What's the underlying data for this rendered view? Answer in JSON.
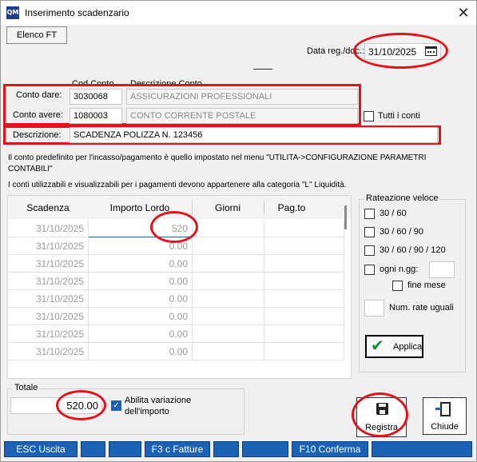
{
  "window": {
    "title": "Inserimento scadenzario",
    "icon_text": "QM",
    "close_glyph": "✕"
  },
  "toolbar": {
    "elenco_ft_label": "Elenco FT"
  },
  "date": {
    "label": "Data reg./doc.:",
    "value": "31/10/2025"
  },
  "accounts": {
    "col_code_header": "Cod.Conto",
    "col_desc_header": "Descrizione Conto",
    "dare_label": "Conto dare:",
    "dare_code": "3030068",
    "dare_desc": "ASSICURAZIONI PROFESSIONALI",
    "avere_label": "Conto avere:",
    "avere_code": "1080003",
    "avere_desc": "CONTO CORRENTE POSTALE",
    "tutti_conti_label": "Tutti i conti"
  },
  "description": {
    "label": "Descrizione:",
    "value": "SCADENZA POLIZZA N. 123456"
  },
  "info": {
    "line1": "Il conto predefinito per l'incasso/pagamento è quello impostato nel menu \"UTILITA->CONFIGURAZIONE PARAMETRI CONTABILI\"",
    "line2": "I conti utilizzabili e visualizzabili per i pagamenti devono appartenere alla categoria \"L\" Liquidità."
  },
  "grid": {
    "headers": [
      "Scadenza",
      "Importo Lordo",
      "Giorni",
      "Pag.to"
    ],
    "rows": [
      {
        "scadenza": "31/10/2025",
        "importo": "520"
      },
      {
        "scadenza": "31/10/2025",
        "importo": "0.00"
      },
      {
        "scadenza": "31/10/2025",
        "importo": "0.00"
      },
      {
        "scadenza": "31/10/2025",
        "importo": "0.00"
      },
      {
        "scadenza": "31/10/2025",
        "importo": "0.00"
      },
      {
        "scadenza": "31/10/2025",
        "importo": "0.00"
      },
      {
        "scadenza": "31/10/2025",
        "importo": "0.00"
      },
      {
        "scadenza": "31/10/2025",
        "importo": "0.00"
      }
    ]
  },
  "rateazione": {
    "title": "Rateazione veloce",
    "opt1": "30 / 60",
    "opt2": "30 / 60 / 90",
    "opt3": "30 / 60 / 90 / 120",
    "ogni_label": "ogni n.gg:",
    "fine_mese_label": "fine mese",
    "num_rate_label": "Num. rate uguali",
    "applica_label": "Applica"
  },
  "totale": {
    "title": "Totale",
    "value": "520.00",
    "abilita_label_1": "Abilita variazione",
    "abilita_label_2": "dell'importo"
  },
  "actions": {
    "registra_label": "Registra",
    "chiude_label": "Chiude"
  },
  "fkeys": [
    {
      "label": "ESC Uscita"
    },
    {
      "label": ""
    },
    {
      "label": ""
    },
    {
      "label": "F3 c Fatture"
    },
    {
      "label": ""
    },
    {
      "label": ""
    },
    {
      "label": "F10 Conferma"
    },
    {
      "label": ""
    }
  ],
  "colors": {
    "annotation_red": "#e0141c",
    "fkey_blue": "#1b62b5",
    "check_green": "#1a8a3a"
  }
}
